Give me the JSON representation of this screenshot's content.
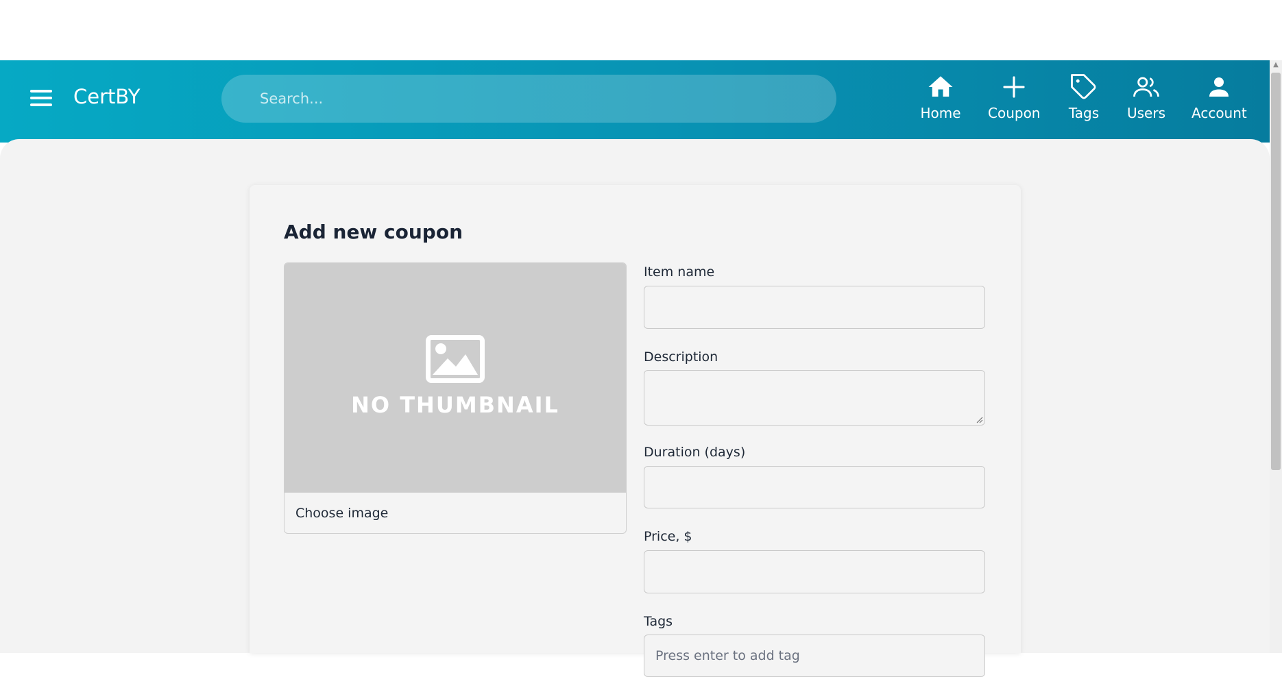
{
  "app": {
    "title": "CertBY"
  },
  "search": {
    "placeholder": "Search..."
  },
  "nav": {
    "home": "Home",
    "coupon": "Coupon",
    "tags": "Tags",
    "users": "Users",
    "account": "Account"
  },
  "form": {
    "title": "Add new coupon",
    "thumbnail_text": "NO THUMBNAIL",
    "choose_image": "Choose image",
    "fields": {
      "item_name": {
        "label": "Item name",
        "value": ""
      },
      "description": {
        "label": "Description",
        "value": ""
      },
      "duration": {
        "label": "Duration (days)",
        "value": ""
      },
      "price": {
        "label": "Price, $",
        "value": ""
      },
      "tags": {
        "label": "Tags",
        "placeholder": "Press enter to add tag"
      }
    }
  },
  "colors": {
    "header_start": "#06a9c4",
    "header_end": "#067c9e",
    "background": "#f3f3f3"
  },
  "icons": [
    "menu-icon",
    "home-icon",
    "plus-icon",
    "tag-icon",
    "users-icon",
    "account-icon",
    "image-placeholder-icon"
  ]
}
